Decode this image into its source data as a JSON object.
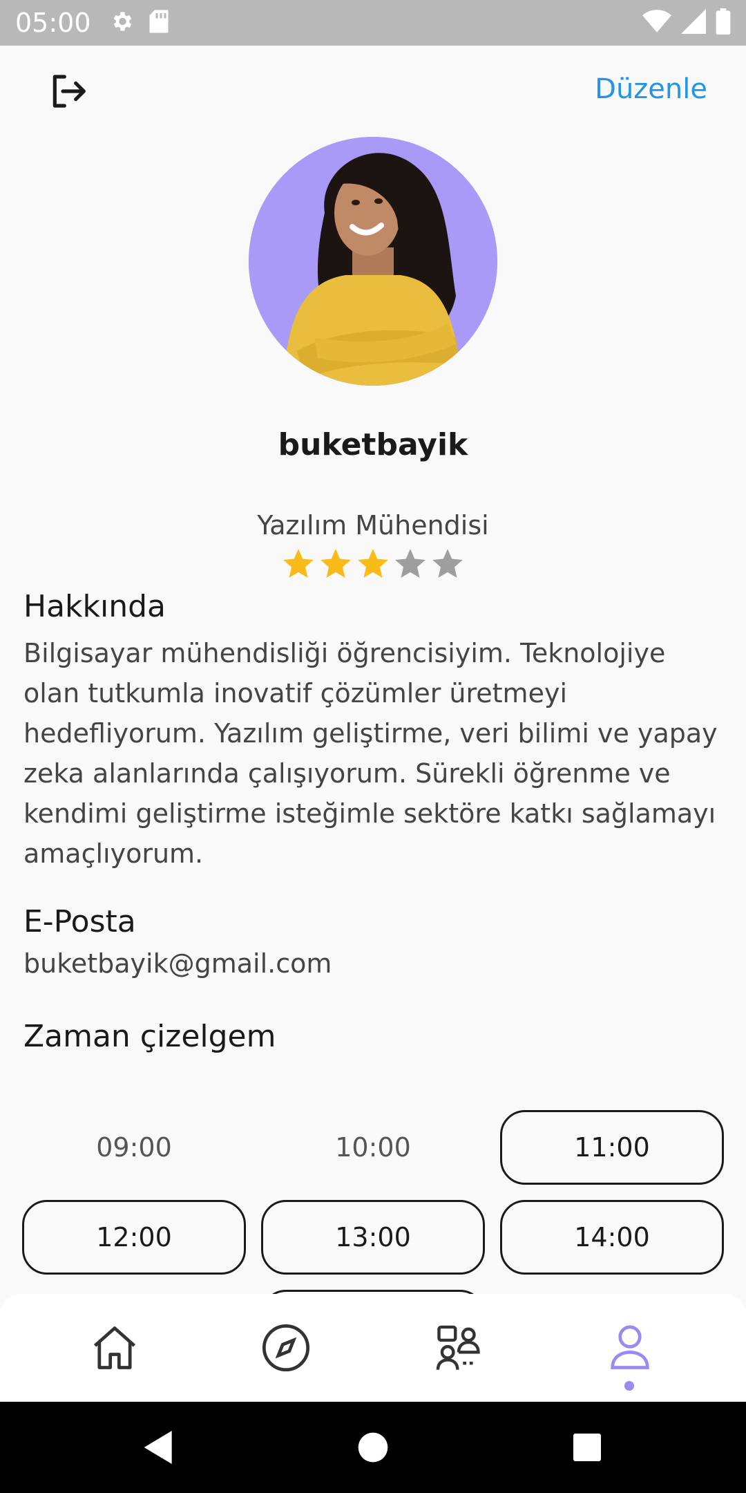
{
  "status_bar": {
    "time": "05:00",
    "left_icons": [
      "gear-icon",
      "sd-card-icon"
    ],
    "right_icons": [
      "wifi-icon",
      "signal-icon",
      "battery-icon"
    ]
  },
  "header": {
    "logout_icon": "logout-icon",
    "edit_label": "Düzenle"
  },
  "profile": {
    "username": "buketbayik",
    "job_title": "Yazılım Mühendisi",
    "rating": 3,
    "rating_max": 5
  },
  "about": {
    "title": "Hakkında",
    "text": "Bilgisayar mühendisliği öğrencisiyim. Teknolojiye olan tutkumla inovatif çözümler üretmeyi hedefliyorum. Yazılım geliştirme, veri bilimi ve yapay zeka alanlarında çalışıyorum. Sürekli öğrenme ve kendimi geliştirme isteğimle sektöre katkı sağlamayı amaçlıyorum."
  },
  "email": {
    "title": "E-Posta",
    "value": "buketbayik@gmail.com"
  },
  "schedule": {
    "title": "Zaman çizelgem",
    "slots": [
      {
        "time": "09:00",
        "selected": false
      },
      {
        "time": "10:00",
        "selected": false
      },
      {
        "time": "11:00",
        "selected": true
      },
      {
        "time": "12:00",
        "selected": true
      },
      {
        "time": "13:00",
        "selected": true
      },
      {
        "time": "14:00",
        "selected": true
      },
      {
        "time": "",
        "selected": true
      }
    ]
  },
  "bottom_nav": {
    "items": [
      "home-icon",
      "compass-icon",
      "mentors-icon",
      "profile-icon"
    ],
    "active": "profile-icon",
    "accent": "#9b8af0"
  },
  "colors": {
    "accent_blue": "#2196e6",
    "star_filled": "#f8bb18",
    "star_empty": "#9e9e9e",
    "avatar_bg": "#a99af7"
  }
}
